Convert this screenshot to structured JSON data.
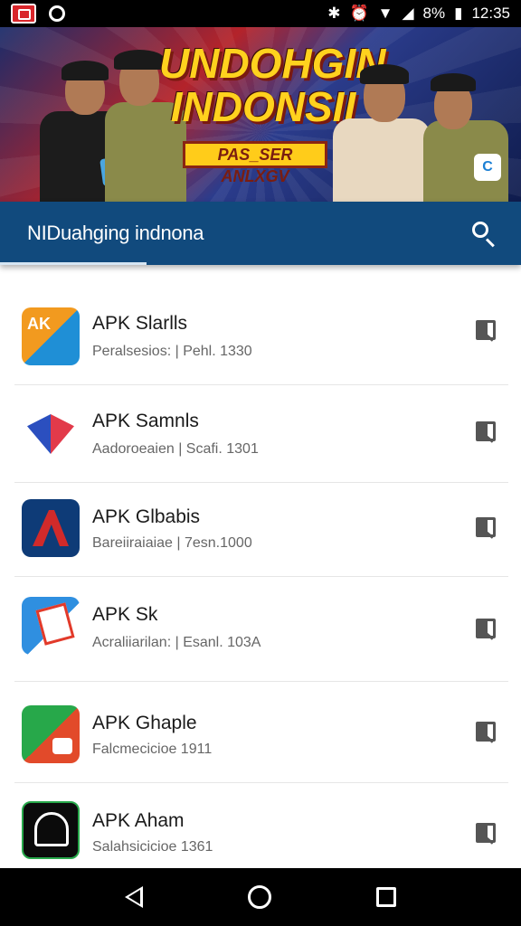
{
  "status_bar": {
    "battery": "8%",
    "time": "12:35"
  },
  "banner": {
    "title": "UNDOHGIN INDONSII",
    "tag": "PAS_SER ANLXGV"
  },
  "app_bar": {
    "title": "NIDuahging indnona"
  },
  "apps": [
    {
      "name": "APK Slarlls",
      "meta": "Peralsesios: | Pehl. 1330",
      "colors": [
        "#f08a1c",
        "#1f8fd6"
      ]
    },
    {
      "name": "APK Samnls",
      "meta": "Aadoroeaien | Scafi. 1301",
      "colors": [
        "#e23a4a",
        "#2b4fbf"
      ]
    },
    {
      "name": "APK Glbabis",
      "meta": "Bareiiraiaiae | 7esn.1000",
      "colors": [
        "#0e3b77",
        "#d12a2a"
      ]
    },
    {
      "name": "APK Sk",
      "meta": "Acraliiarilan: | Esanl. 103A",
      "colors": [
        "#2f8fe0",
        "#e23a2a"
      ]
    },
    {
      "name": "APK Ghaple",
      "meta": "Falcmecicioe 1911",
      "colors": [
        "#27a84a",
        "#e24a2a"
      ]
    },
    {
      "name": "APK Aham",
      "meta": "Salahsicicioe 1361",
      "colors": [
        "#0b0b0b",
        "#ffffff"
      ]
    }
  ]
}
